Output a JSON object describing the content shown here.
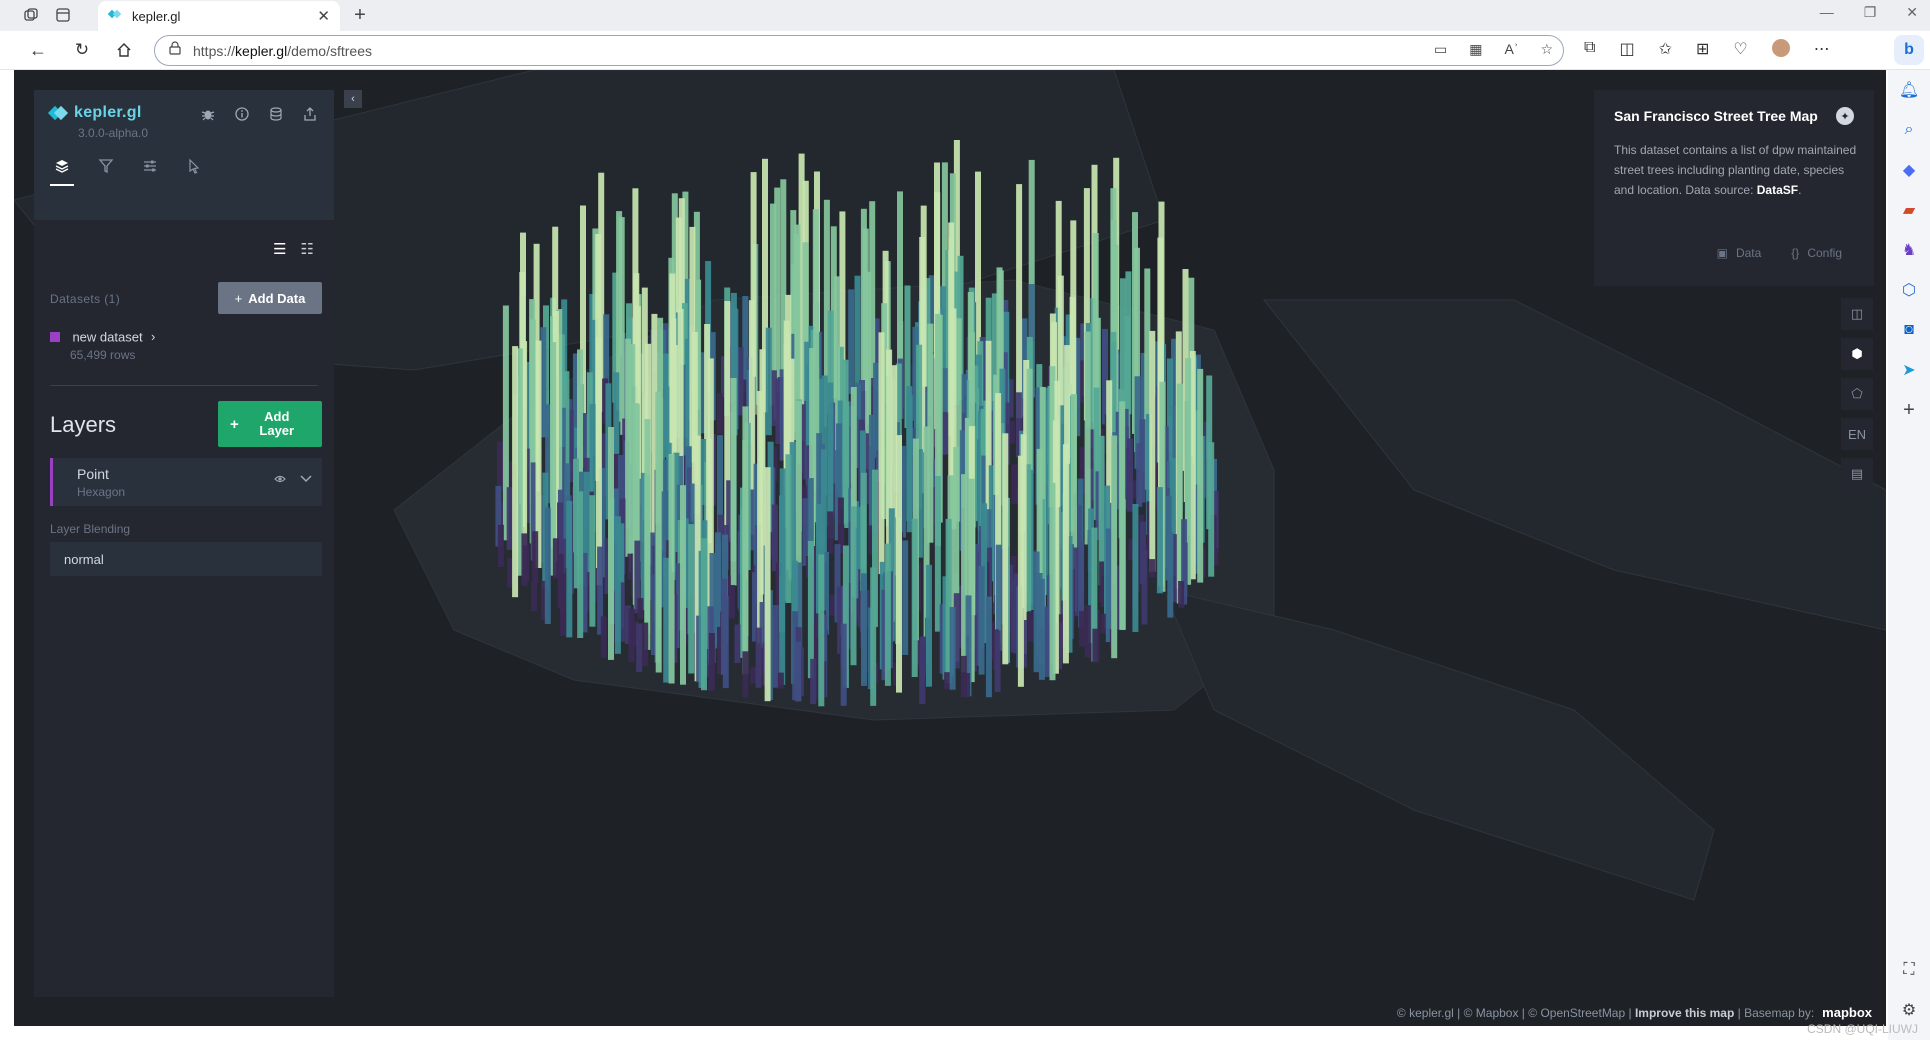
{
  "browser": {
    "tab_title": "kepler.gl",
    "url_prefix": "https://",
    "url_host": "kepler.gl",
    "url_path": "/demo/sftrees",
    "read_aloud": "Aʾ"
  },
  "kepler": {
    "app_name": "kepler.gl",
    "version": "3.0.0-alpha.0",
    "datasets_title": "Datasets (1)",
    "add_data_label": "Add Data",
    "dataset_name": "new dataset",
    "dataset_rows": "65,499 rows",
    "dataset_color": "#9b3fc5",
    "layers_title": "Layers",
    "add_layer_label": "Add Layer",
    "layer_name": "Point",
    "layer_type": "Hexagon",
    "blending_label": "Layer Blending",
    "blending_value": "normal",
    "accent_green": "#1fa66a"
  },
  "info_panel": {
    "title": "San Francisco Street Tree Map",
    "description": "This dataset contains a list of dpw maintained street trees including planting date, species and location. Data source: ",
    "source_link": "DataSF",
    "data_label": "Data",
    "config_label": "Config"
  },
  "map_controls": {
    "locale": "EN"
  },
  "attribution": {
    "kepler": "© kepler.gl",
    "mapbox": "© Mapbox",
    "osm": "© OpenStreetMap",
    "improve": "Improve this map",
    "basemap": "Basemap by:",
    "mapbox_logo": "mapbox"
  },
  "watermark": "CSDN @UQI-LIUWJ"
}
